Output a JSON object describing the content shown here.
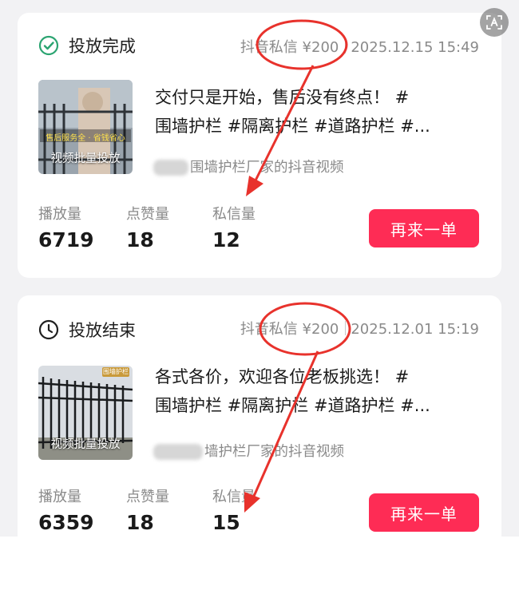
{
  "cards": [
    {
      "status": "投放完成",
      "status_icon": "check-circle-icon",
      "status_color": "#2ba471",
      "channel_price": "抖音私信 ¥200",
      "datetime": "2025.12.15 15:49",
      "thumb_caption": "视频批量投放",
      "thumb_overlay_text": "售后服务全 · 省钱省心",
      "title": "交付只是开始，售后没有终点！ #围墙护栏 #隔离护栏 #道路护栏 #...",
      "title_line1": "交付只是开始，售后没有终点！ #",
      "title_line2": "围墙护栏 #隔离护栏 #道路护栏 #...",
      "source": "围墙护栏厂家的抖音视频",
      "stats": [
        {
          "label": "播放量",
          "value": "6719"
        },
        {
          "label": "点赞量",
          "value": "18"
        },
        {
          "label": "私信量",
          "value": "12"
        }
      ],
      "button": "再来一单"
    },
    {
      "status": "投放结束",
      "status_icon": "clock-icon",
      "status_color": "#1f1f1f",
      "channel_price": "抖音私信 ¥200",
      "datetime": "2025.12.01 15:19",
      "thumb_caption": "视频批量投放",
      "thumb_overlay_text": "围墙护栏",
      "title": "各式各价，欢迎各位老板挑选！ #围墙护栏 #隔离护栏 #道路护栏 #...",
      "title_line1": "各式各价，欢迎各位老板挑选！ #",
      "title_line2": "围墙护栏 #隔离护栏 #道路护栏 #...",
      "source": "墙护栏厂家的抖音视频",
      "stats": [
        {
          "label": "播放量",
          "value": "6359"
        },
        {
          "label": "点赞量",
          "value": "18"
        },
        {
          "label": "私信量",
          "value": "15"
        }
      ],
      "button": "再来一单"
    }
  ],
  "colors": {
    "accent": "#fe2c55",
    "annotation": "#e8322c",
    "muted_text": "#8a8a8a",
    "page_bg": "#f2f2f4"
  },
  "corner_button_icon": "image-text-recognition-icon"
}
